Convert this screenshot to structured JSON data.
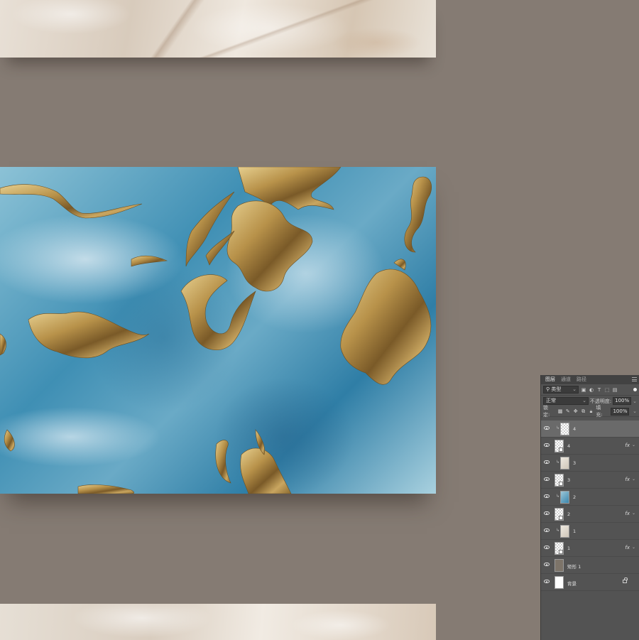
{
  "canvas": {
    "artboards": [
      "marble-top",
      "marble-blue-gold",
      "marble-bottom"
    ]
  },
  "layers_panel": {
    "tabs": [
      "图层",
      "通道",
      "路径"
    ],
    "active_tab": "图层",
    "filter": {
      "label": "类型",
      "icons": [
        "image-filter-icon",
        "adjustment-filter-icon",
        "type-filter-icon",
        "shape-filter-icon",
        "smart-object-filter-icon"
      ]
    },
    "blend_mode": "正常",
    "opacity_label": "不透明度:",
    "opacity_value": "100%",
    "lock_label": "锁定:",
    "fill_label": "填充:",
    "fill_value": "100%",
    "layers": [
      {
        "name": "4",
        "thumb": "checker",
        "clipped": true,
        "selected": true,
        "fx": false
      },
      {
        "name": "4",
        "thumb": "checker",
        "clipped": false,
        "selected": false,
        "fx": true
      },
      {
        "name": "3",
        "thumb": "marble",
        "clipped": true,
        "selected": false,
        "fx": false
      },
      {
        "name": "3",
        "thumb": "checker",
        "clipped": false,
        "selected": false,
        "fx": true
      },
      {
        "name": "2",
        "thumb": "blue",
        "clipped": true,
        "selected": false,
        "fx": false
      },
      {
        "name": "2",
        "thumb": "checker",
        "clipped": false,
        "selected": false,
        "fx": true
      },
      {
        "name": "1",
        "thumb": "marble",
        "clipped": true,
        "selected": false,
        "fx": false
      },
      {
        "name": "1",
        "thumb": "checker",
        "clipped": false,
        "selected": false,
        "fx": true
      },
      {
        "name": "矩形 1",
        "thumb": "brown",
        "clipped": false,
        "selected": false,
        "fx": false
      },
      {
        "name": "背景",
        "thumb": "white",
        "clipped": false,
        "selected": false,
        "fx": false,
        "locked": true
      }
    ],
    "colors": {
      "panel_bg": "#535353",
      "header_bg": "#424242",
      "selected_row": "#6a6a6a",
      "canvas_bg": "#857b73"
    }
  }
}
